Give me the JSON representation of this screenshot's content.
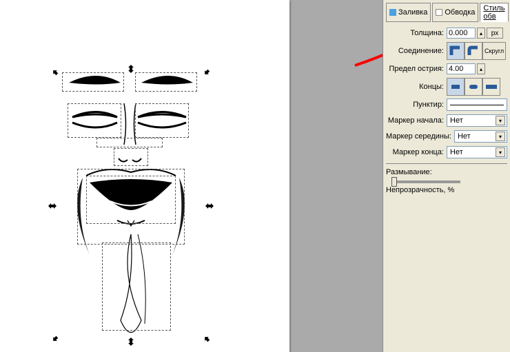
{
  "tabs": {
    "fill": "Заливка",
    "stroke": "Обводка",
    "style": "Стиль обв"
  },
  "fields": {
    "width_label": "Толщина:",
    "width_value": "0.000",
    "width_unit": "px",
    "join_label": "Соединение:",
    "round_label": "Скругл",
    "miter_label": "Предел острия:",
    "miter_value": "4.00",
    "cap_label": "Концы:",
    "dash_label": "Пунктир:",
    "marker_start_label": "Маркер начала:",
    "marker_mid_label": "Маркер середины:",
    "marker_end_label": "Маркер конца:",
    "marker_none": "Нет",
    "blur_label": "Размывание:",
    "opacity_label": "Непрозрачность, %"
  },
  "colors": {
    "panel_bg": "#ece9d8",
    "fill_swatch": "#4aa3e0",
    "stroke_swatch": "#ffffff",
    "arrow": "#ff0000"
  }
}
